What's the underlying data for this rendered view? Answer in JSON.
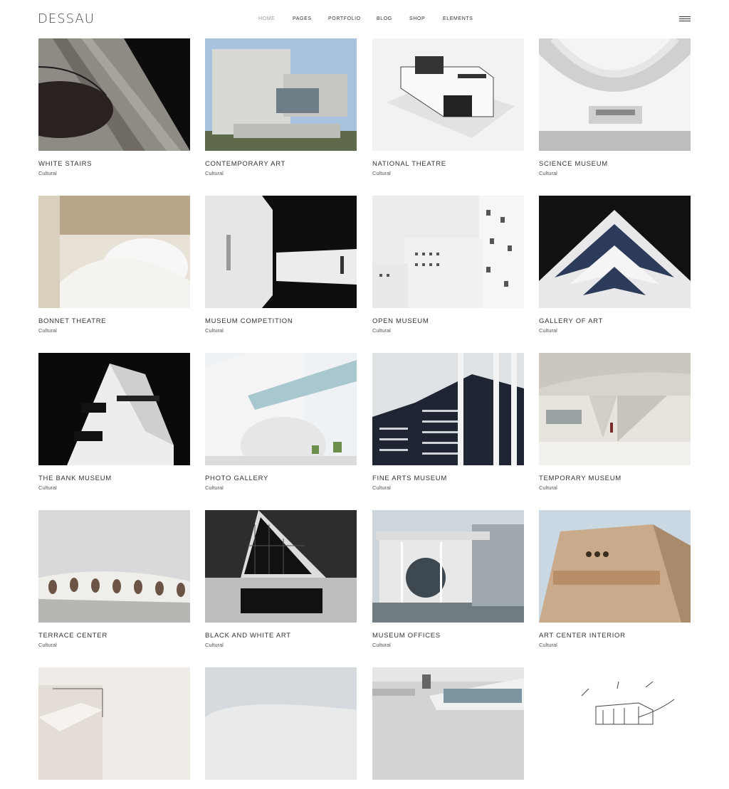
{
  "header": {
    "logo": "DESSAU",
    "nav": [
      {
        "label": "HOME",
        "active": true
      },
      {
        "label": "PAGES",
        "active": false
      },
      {
        "label": "PORTFOLIO",
        "active": false
      },
      {
        "label": "BLOG",
        "active": false
      },
      {
        "label": "SHOP",
        "active": false
      },
      {
        "label": "ELEMENTS",
        "active": false
      }
    ],
    "menu_icon": "hamburger-menu-icon"
  },
  "portfolio": [
    {
      "title": "WHITE STAIRS",
      "category": "Cultural"
    },
    {
      "title": "CONTEMPORARY ART",
      "category": "Cultural"
    },
    {
      "title": "NATIONAL THEATRE",
      "category": "Cultural"
    },
    {
      "title": "SCIENCE MUSEUM",
      "category": "Cultural"
    },
    {
      "title": "BONNET THEATRE",
      "category": "Cultural"
    },
    {
      "title": "MUSEUM COMPETITION",
      "category": "Cultural"
    },
    {
      "title": "OPEN MUSEUM",
      "category": "Cultural"
    },
    {
      "title": "GALLERY OF ART",
      "category": "Cultural"
    },
    {
      "title": "THE BANK MUSEUM",
      "category": "Cultural"
    },
    {
      "title": "PHOTO GALLERY",
      "category": "Cultural"
    },
    {
      "title": "FINE ARTS MUSEUM",
      "category": "Cultural"
    },
    {
      "title": "TEMPORARY MUSEUM",
      "category": "Cultural"
    },
    {
      "title": "TERRACE CENTER",
      "category": "Cultural"
    },
    {
      "title": "BLACK AND WHITE ART",
      "category": "Cultural"
    },
    {
      "title": "MUSEUM OFFICES",
      "category": "Cultural"
    },
    {
      "title": "ART CENTER INTERIOR",
      "category": "Cultural"
    },
    {
      "title": "",
      "category": ""
    },
    {
      "title": "",
      "category": ""
    },
    {
      "title": "",
      "category": ""
    },
    {
      "title": "",
      "category": ""
    }
  ]
}
